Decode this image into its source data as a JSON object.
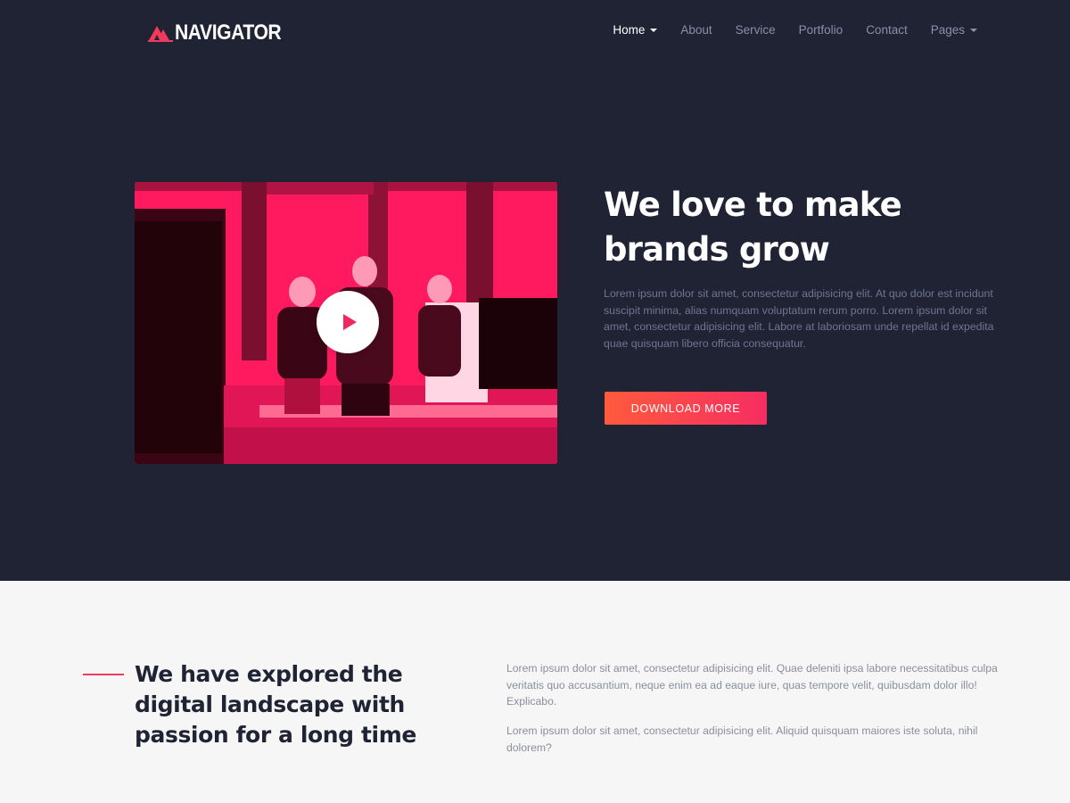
{
  "brand": {
    "name": "NAVIGATOR",
    "logo_icon": "mountain-logo-icon",
    "accent_color": "#ef3a5d"
  },
  "nav": {
    "items": [
      {
        "label": "Home",
        "active": true,
        "dropdown": true
      },
      {
        "label": "About",
        "active": false,
        "dropdown": false
      },
      {
        "label": "Service",
        "active": false,
        "dropdown": false
      },
      {
        "label": "Portfolio",
        "active": false,
        "dropdown": false
      },
      {
        "label": "Contact",
        "active": false,
        "dropdown": false
      },
      {
        "label": "Pages",
        "active": false,
        "dropdown": true
      }
    ]
  },
  "hero": {
    "title": "We love to make brands grow",
    "text": "Lorem ipsum dolor sit amet, consectetur adipisicing elit. At quo dolor est incidunt suscipit minima, alias numquam voluptatum rerum porro. Lorem ipsum dolor sit amet, consectetur adipisicing elit. Labore at laboriosam unde repellat id expedita quae quisquam libero officia consequatur.",
    "cta_label": "DOWNLOAD MORE",
    "video_icon": "play-icon",
    "background_color": "#1f2333",
    "video_tint": "#ff1f63"
  },
  "about": {
    "title": "We have explored the digital landscape with passion for a long time",
    "paragraph_1": "Lorem ipsum dolor sit amet, consectetur adipisicing elit. Quae deleniti ipsa labore necessitatibus culpa veritatis quo accusantium, neque enim ea ad eaque iure, quas tempore velit, quibusdam dolor illo! Explicabo.",
    "paragraph_2": "Lorem ipsum dolor sit amet, consectetur adipisicing elit. Aliquid quisquam maiores iste soluta, nihil dolorem?",
    "background_color": "#f6f6f6"
  }
}
